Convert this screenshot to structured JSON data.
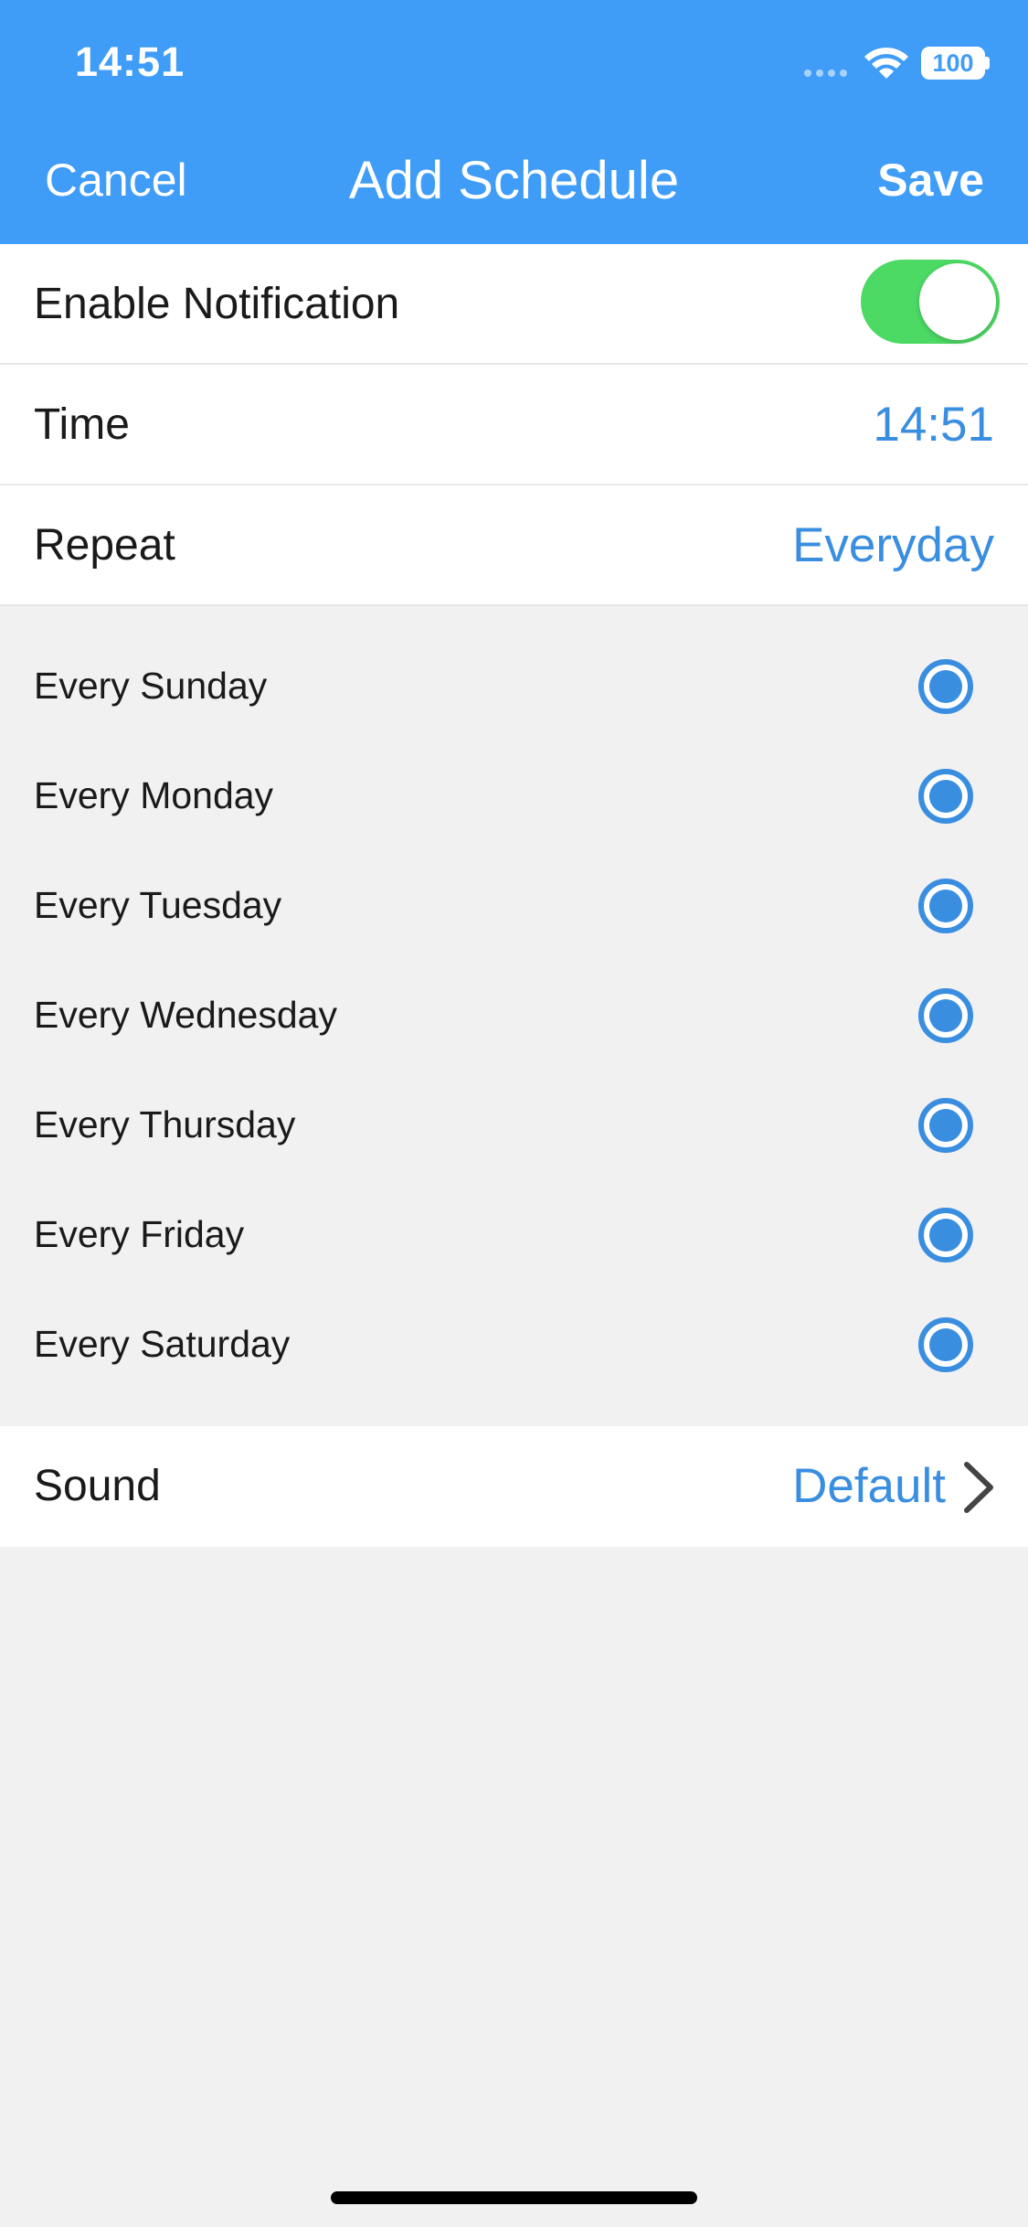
{
  "status_bar": {
    "time": "14:51",
    "battery": "100"
  },
  "nav": {
    "cancel_label": "Cancel",
    "title": "Add Schedule",
    "save_label": "Save"
  },
  "settings": {
    "enable_notification": {
      "label": "Enable Notification",
      "enabled": true
    },
    "time": {
      "label": "Time",
      "value": "14:51"
    },
    "repeat": {
      "label": "Repeat",
      "value": "Everyday"
    }
  },
  "days": [
    {
      "label": "Every Sunday",
      "selected": true
    },
    {
      "label": "Every Monday",
      "selected": true
    },
    {
      "label": "Every Tuesday",
      "selected": true
    },
    {
      "label": "Every Wednesday",
      "selected": true
    },
    {
      "label": "Every Thursday",
      "selected": true
    },
    {
      "label": "Every Friday",
      "selected": true
    },
    {
      "label": "Every Saturday",
      "selected": true
    }
  ],
  "sound": {
    "label": "Sound",
    "value": "Default"
  },
  "colors": {
    "header": "#3f9cf7",
    "accent": "#3a8ee0",
    "toggle_on": "#4cd964",
    "background": "#f1f1f1"
  }
}
